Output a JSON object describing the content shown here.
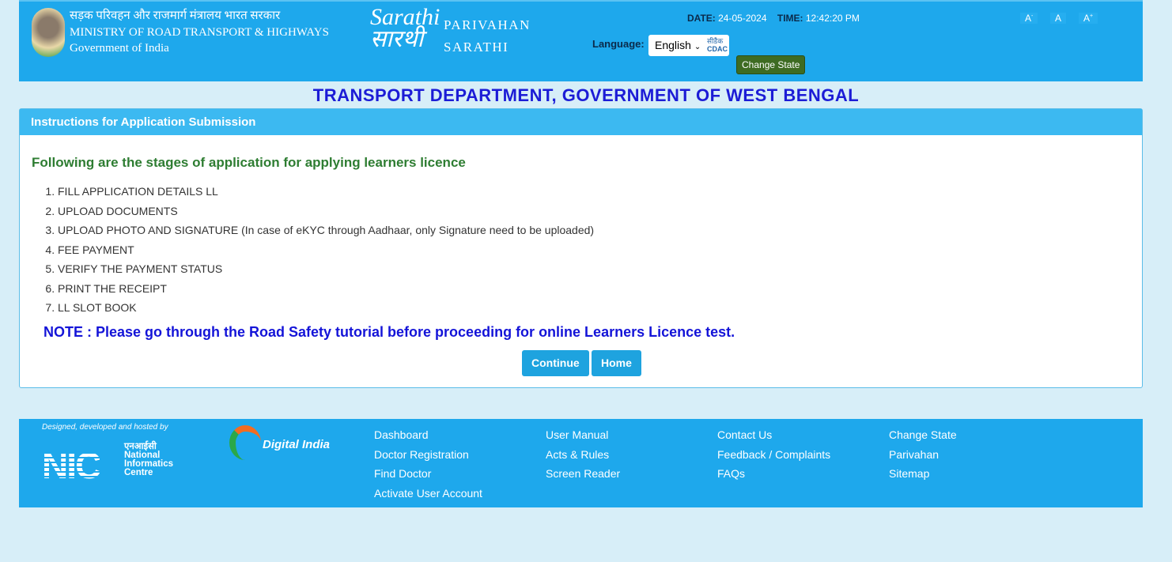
{
  "header": {
    "ministry_hindi": "सड़क परिवहन और राजमार्ग मंत्रालय भारत सरकार",
    "ministry": "MINISTRY OF ROAD TRANSPORT & HIGHWAYS",
    "government": "Government of India",
    "sarathi_logo": "Sarathi सारथी",
    "parivahan": "PARIVAHAN",
    "sarathi": "SARATHI",
    "date_label": "DATE:",
    "date": "24-05-2024",
    "time_label": "TIME:",
    "time": "12:42:20 PM",
    "language_label": "Language:",
    "language": "English",
    "cdac": "सीडैक CDAC",
    "change_state": "Change State",
    "font_small": "A-",
    "font_normal": "A",
    "font_large": "A+"
  },
  "page_title": "TRANSPORT DEPARTMENT, GOVERNMENT OF WEST BENGAL",
  "panel": {
    "heading": "Instructions for Application Submission",
    "stages_title": "Following are the stages of application for applying learners licence",
    "stages": [
      "FILL APPLICATION DETAILS LL",
      "UPLOAD DOCUMENTS",
      "UPLOAD PHOTO AND SIGNATURE (In case of eKYC through Aadhaar, only Signature need to be uploaded)",
      "FEE PAYMENT",
      "VERIFY THE PAYMENT STATUS",
      "PRINT THE RECEIPT",
      "LL SLOT BOOK"
    ],
    "note": "NOTE : Please go through the Road Safety tutorial before proceeding for online Learners Licence test.",
    "continue": "Continue",
    "home": "Home"
  },
  "footer": {
    "designed": "Designed, developed and hosted by",
    "nic": "NIC",
    "nic_text": "एनआईसी National Informatics Centre",
    "digital_india": "Digital India",
    "columns": [
      [
        "Dashboard",
        "Doctor Registration",
        "Find Doctor",
        "Activate User Account"
      ],
      [
        "User Manual",
        "Acts & Rules",
        "Screen Reader"
      ],
      [
        "Contact Us",
        "Feedback / Complaints",
        "FAQs"
      ],
      [
        "Change State",
        "Parivahan",
        "Sitemap"
      ]
    ]
  },
  "colors": {
    "header": "#1ea8ec",
    "title": "#1c1cd6",
    "stages": "#2e7d32",
    "button": "#1ea3df",
    "change_state": "#3e6b22"
  }
}
